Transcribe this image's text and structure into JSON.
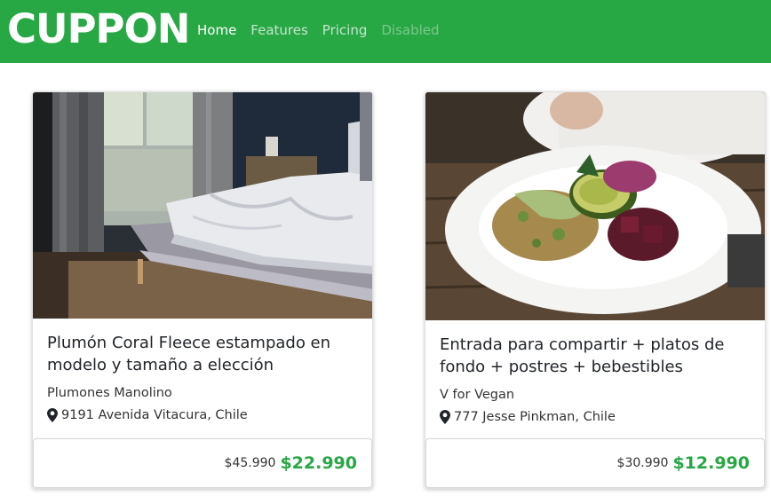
{
  "brand": "CUPPON",
  "nav": [
    {
      "label": "Home"
    },
    {
      "label": "Features"
    },
    {
      "label": "Pricing"
    },
    {
      "label": "Disabled"
    }
  ],
  "colors": {
    "primary": "#28a745"
  },
  "cards": [
    {
      "title": "Plumón Coral Fleece estampado en modelo y tamaño a elección",
      "vendor": "Plumones Manolino",
      "address": "9191 Avenida Vitacura, Chile",
      "old_price": "$45.990",
      "new_price": "$22.990",
      "icon": "map-marker-icon"
    },
    {
      "title": "Entrada para compartir + platos de fondo + postres + bebestibles",
      "vendor": "V for Vegan",
      "address": "777 Jesse Pinkman, Chile",
      "old_price": "$30.990",
      "new_price": "$12.990",
      "icon": "map-marker-icon"
    }
  ]
}
